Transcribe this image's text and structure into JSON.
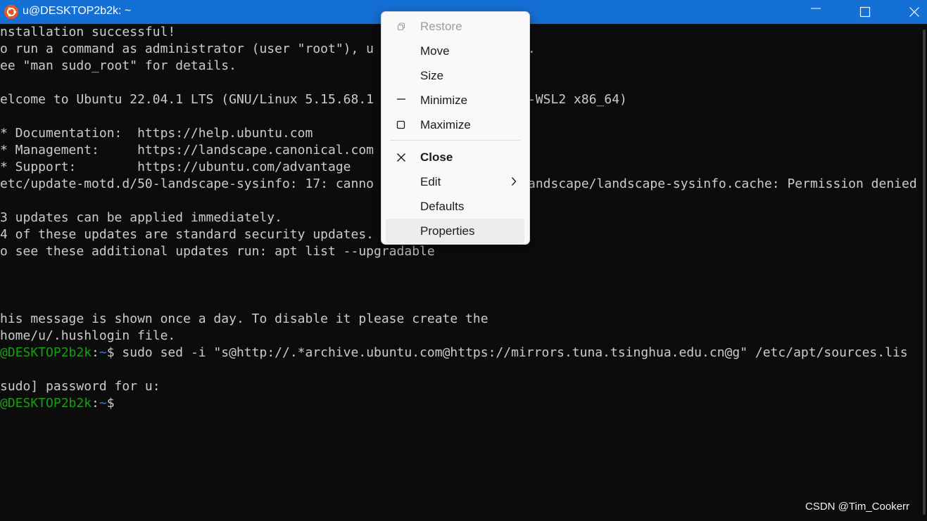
{
  "window": {
    "title": "u@DESKTOP2b2k: ~",
    "app_icon": "ubuntu-icon",
    "controls": [
      "minimize-icon",
      "maximize-icon",
      "close-icon"
    ],
    "titlebar_color": "#1570d6"
  },
  "terminal": {
    "lines": [
      "nstallation successful!",
      "o run a command as administrator (user \"root\"), u",
      "ee \"man sudo_root\" for details.",
      "",
      "elcome to Ubuntu 22.04.1 LTS (GNU/Linux 5.15.68.1",
      "",
      "* Documentation:  https://help.ubuntu.com",
      "* Management:     https://landscape.canonical.com",
      "* Support:        https://ubuntu.com/advantage",
      "etc/update-motd.d/50-landscape-sysinfo: 17: canno",
      "",
      "3 updates can be applied immediately.",
      "4 of these updates are standard security updates.",
      "o see these additional updates run: apt list --upgradable",
      "",
      "",
      "",
      "his message is shown once a day. To disable it please create the",
      "home/u/.hushlogin file."
    ],
    "right_fragments": {
      "line2": ".",
      "line5": "-WSL2 x86_64)",
      "line10": "andscape/landscape-sysinfo.cache: Permission denied"
    },
    "prompt": {
      "user_host": "@DESKTOP2b2k",
      "colon": ":",
      "path": "~",
      "symbol": "$"
    },
    "command": " sudo sed -i \"s@http://.*archive.ubuntu.com@https://mirrors.tuna.tsinghua.edu.cn@g\" /etc/apt/sources.lis",
    "password_prompt": "sudo] password for u:",
    "colors": {
      "background": "#0c0c0c",
      "text": "#cccccc",
      "prompt_user": "#13a10e",
      "prompt_path": "#3b78ff"
    }
  },
  "context_menu": {
    "items": [
      {
        "label": "Restore",
        "icon": "restore-icon",
        "state": "disabled"
      },
      {
        "label": "Move",
        "icon": ""
      },
      {
        "label": "Size",
        "icon": ""
      },
      {
        "label": "Minimize",
        "icon": "minimize-icon"
      },
      {
        "label": "Maximize",
        "icon": "maximize-icon"
      },
      {
        "label": "Close",
        "icon": "close-icon",
        "bold": true
      },
      {
        "label": "Edit",
        "icon": "",
        "submenu": "chevron-right-icon"
      },
      {
        "label": "Defaults",
        "icon": ""
      },
      {
        "label": "Properties",
        "icon": "",
        "state": "hovered"
      }
    ]
  },
  "watermark": "CSDN @Tim_Cookerr"
}
